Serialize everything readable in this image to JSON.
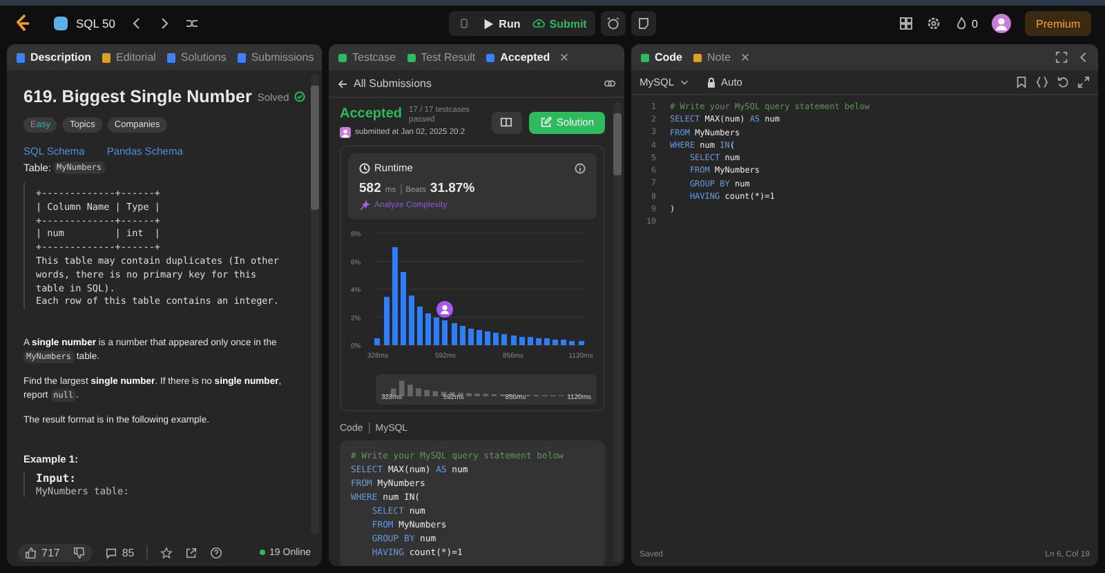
{
  "topbar": {
    "list_name": "SQL 50",
    "run": "Run",
    "submit": "Submit",
    "streak": "0",
    "premium": "Premium"
  },
  "description": {
    "tabs": [
      {
        "label": "Description",
        "selected": true
      },
      {
        "label": "Editorial",
        "selected": false
      },
      {
        "label": "Solutions",
        "selected": false
      },
      {
        "label": "Submissions",
        "selected": false
      }
    ],
    "title": "619. Biggest Single Number",
    "status": "Solved",
    "tags": [
      "Easy",
      "Topics",
      "Companies"
    ],
    "schema_links": [
      "SQL Schema",
      "Pandas Schema"
    ],
    "table_label": "Table:",
    "table_name": "MyNumbers",
    "schema_lines": [
      "+-------------+------+",
      "| Column Name | Type |",
      "+-------------+------+",
      "| num         | int  |",
      "+-------------+------+",
      "This table may contain duplicates (In other",
      "words, there is no primary key for this",
      "table in SQL).",
      "Each row of this table contains an integer."
    ],
    "paragraphs": [
      [
        {
          "kind": "text",
          "s": "A "
        },
        {
          "kind": "bold",
          "s": "single number"
        },
        {
          "kind": "text",
          "s": " is a number that appeared only once in the "
        },
        {
          "kind": "code",
          "s": "MyNumbers"
        },
        {
          "kind": "text",
          "s": " table."
        }
      ],
      [
        {
          "kind": "text",
          "s": "Find the largest "
        },
        {
          "kind": "bold",
          "s": "single number"
        },
        {
          "kind": "text",
          "s": ". If there is no "
        },
        {
          "kind": "bold",
          "s": "single number"
        },
        {
          "kind": "text",
          "s": ", report "
        },
        {
          "kind": "code",
          "s": "null"
        },
        {
          "kind": "text",
          "s": "."
        }
      ],
      [
        {
          "kind": "text",
          "s": "The result format is in the following example."
        }
      ]
    ],
    "example_heading": "Example 1:",
    "example_input": "Input:",
    "example_line": "MyNumbers table:",
    "footer": {
      "likes": "717",
      "comments": "85",
      "online": "19 Online"
    }
  },
  "result": {
    "tabs": [
      {
        "label": "Testcase",
        "selected": false
      },
      {
        "label": "Test Result",
        "selected": false
      },
      {
        "label": "Accepted",
        "selected": true
      }
    ],
    "back": "All Submissions",
    "status": "Accepted",
    "testcases": "17 / 17 testcases passed",
    "submitted": "submitted at Jan 02, 2025 20:2",
    "solution": "Solution",
    "runtime_label": "Runtime",
    "runtime_value": "582",
    "runtime_unit": "ms",
    "beats_label": "Beats",
    "beats_value": "31.87%",
    "analyze": "Analyze Complexity",
    "chart_data": {
      "type": "bar",
      "x": [
        328,
        361,
        394,
        427,
        460,
        493,
        526,
        559,
        592,
        625,
        658,
        691,
        724,
        757,
        790,
        823,
        856,
        889,
        922,
        955,
        988,
        1021,
        1054,
        1087,
        1120
      ],
      "values": [
        0.5,
        3.5,
        7.0,
        5.2,
        3.6,
        2.8,
        2.3,
        2.0,
        1.8,
        1.6,
        1.4,
        1.2,
        1.1,
        1.0,
        0.9,
        0.8,
        0.7,
        0.6,
        0.6,
        0.5,
        0.5,
        0.4,
        0.4,
        0.3,
        0.3
      ],
      "xlim": [
        320,
        1128
      ],
      "ylim": [
        0,
        8
      ],
      "xticks": [
        {
          "value": 328,
          "label": "328ms"
        },
        {
          "value": 592,
          "label": "592ms"
        },
        {
          "value": 856,
          "label": "856ms"
        },
        {
          "value": 1120,
          "label": "1120ms"
        }
      ],
      "yticks": [
        {
          "value": 0,
          "label": "0%"
        },
        {
          "value": 2,
          "label": "2%"
        },
        {
          "value": 4,
          "label": "4%"
        },
        {
          "value": 6,
          "label": "6%"
        },
        {
          "value": 8,
          "label": "8%"
        }
      ],
      "grid": true
    },
    "overview_labels": [
      "328ms",
      "592ms",
      "856ms",
      "1120ms"
    ],
    "code_label": "Code",
    "code_lang": "MySQL",
    "code_lines": [
      [
        {
          "kind": "comment",
          "s": "# Write your MySQL query statement below"
        }
      ],
      [
        {
          "kind": "kw",
          "s": "SELECT"
        },
        {
          "kind": "plain",
          "s": " MAX(num) "
        },
        {
          "kind": "kw",
          "s": "AS"
        },
        {
          "kind": "plain",
          "s": " num"
        }
      ],
      [
        {
          "kind": "kw",
          "s": "FROM"
        },
        {
          "kind": "plain",
          "s": " MyNumbers"
        }
      ],
      [
        {
          "kind": "kw",
          "s": "WHERE"
        },
        {
          "kind": "plain",
          "s": " num IN("
        }
      ],
      [
        {
          "kind": "kw",
          "s": "    SELECT"
        },
        {
          "kind": "plain",
          "s": " num"
        }
      ],
      [
        {
          "kind": "kw",
          "s": "    FROM"
        },
        {
          "kind": "plain",
          "s": " MyNumbers"
        }
      ],
      [
        {
          "kind": "kw",
          "s": "    GROUP BY"
        },
        {
          "kind": "plain",
          "s": " num"
        }
      ],
      [
        {
          "kind": "kw",
          "s": "    HAVING"
        },
        {
          "kind": "plain",
          "s": " count(*)=1"
        }
      ]
    ]
  },
  "editor": {
    "tabs": [
      {
        "label": "Code",
        "selected": true
      },
      {
        "label": "Note",
        "selected": false
      }
    ],
    "language": "MySQL",
    "mode": "Auto",
    "lines": [
      {
        "no": "1",
        "tokens": [
          {
            "kind": "comment",
            "s": "# Write your MySQL query statement below"
          }
        ]
      },
      {
        "no": "2",
        "tokens": [
          {
            "kind": "kw",
            "s": "SELECT"
          },
          {
            "kind": "plain",
            "s": " MAX(num) "
          },
          {
            "kind": "kw",
            "s": "AS"
          },
          {
            "kind": "plain",
            "s": " num"
          }
        ]
      },
      {
        "no": "3",
        "tokens": [
          {
            "kind": "kw",
            "s": "FROM"
          },
          {
            "kind": "plain",
            "s": " MyNumbers"
          }
        ]
      },
      {
        "no": "4",
        "tokens": [
          {
            "kind": "kw",
            "s": "WHERE"
          },
          {
            "kind": "plain",
            "s": " num "
          },
          {
            "kind": "kw",
            "s": "IN"
          },
          {
            "kind": "plain",
            "s": "("
          }
        ]
      },
      {
        "no": "5",
        "tokens": [
          {
            "kind": "kw",
            "s": "    SELECT"
          },
          {
            "kind": "plain",
            "s": " num"
          }
        ]
      },
      {
        "no": "6",
        "tokens": [
          {
            "kind": "kw",
            "s": "    FROM"
          },
          {
            "kind": "plain",
            "s": " MyNumbers"
          }
        ]
      },
      {
        "no": "7",
        "tokens": [
          {
            "kind": "kw",
            "s": "    GROUP BY"
          },
          {
            "kind": "plain",
            "s": " num"
          }
        ]
      },
      {
        "no": "8",
        "tokens": [
          {
            "kind": "kw",
            "s": "    HAVING"
          },
          {
            "kind": "plain",
            "s": " count(*)=1"
          }
        ]
      },
      {
        "no": "9",
        "tokens": [
          {
            "kind": "plain",
            "s": ")"
          }
        ]
      },
      {
        "no": "10"
      }
    ],
    "saved": "Saved",
    "cursor": "Ln 6, Col 19"
  }
}
